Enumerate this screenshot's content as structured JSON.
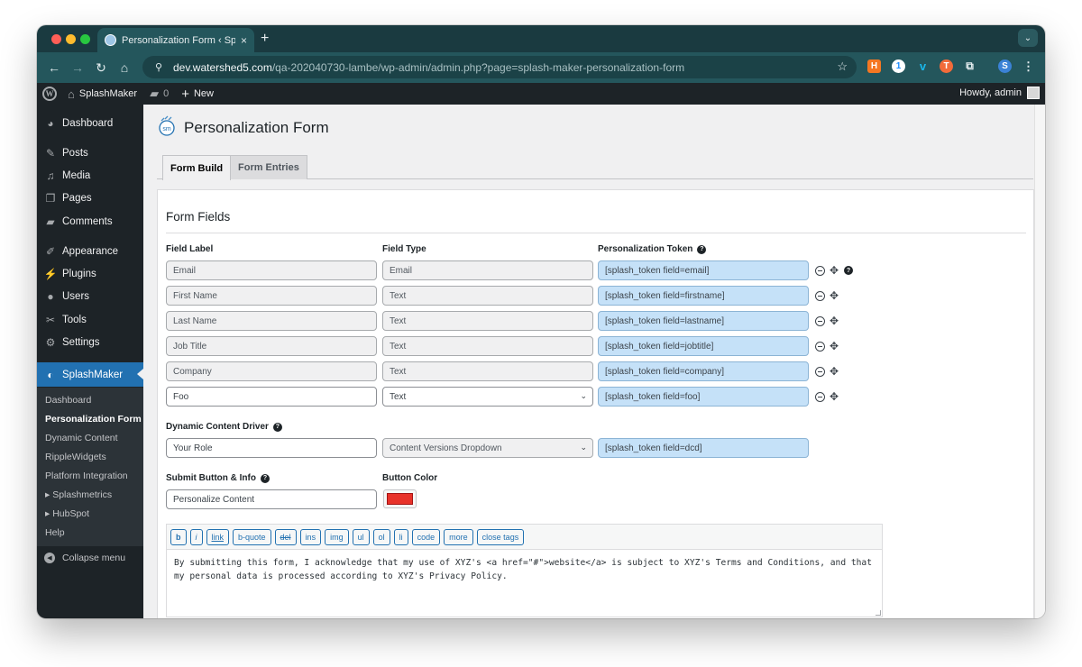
{
  "browser": {
    "tab_title": "Personalization Form ‹ Splash",
    "tab_close": "×",
    "new_tab": "+",
    "tab_menu": "⌄",
    "url_host": "dev.watershed5.com",
    "url_path": "/qa-202040730-lambe/wp-admin/admin.php?page=splash-maker-personalization-form",
    "nav": {
      "back": "←",
      "forward": "→",
      "reload": "↻",
      "home": "⌂"
    },
    "star": "☆",
    "extensions": [
      {
        "name": "hubspot-extension",
        "glyph": "H",
        "color": "#f57722"
      },
      {
        "name": "1password-extension",
        "glyph": "1",
        "color": "#1a8cff"
      },
      {
        "name": "vimeo-extension",
        "glyph": "v",
        "color": "#1ab7ea"
      },
      {
        "name": "t-extension",
        "glyph": "T",
        "color": "#f26b3a"
      },
      {
        "name": "puzzle-extension",
        "glyph": "⧉",
        "color": "#e5eef0"
      }
    ],
    "profile_initial": "S",
    "menu_glyph": "⋮"
  },
  "adminbar": {
    "site_name": "SplashMaker",
    "comments_count": "0",
    "new_label": "New",
    "howdy": "Howdy, admin"
  },
  "sidebar": {
    "items": [
      {
        "label": "Dashboard",
        "icon": "◕"
      },
      {
        "label": "Posts",
        "icon": "✎"
      },
      {
        "label": "Media",
        "icon": "♫"
      },
      {
        "label": "Pages",
        "icon": "❐"
      },
      {
        "label": "Comments",
        "icon": "▰"
      },
      {
        "label": "Appearance",
        "icon": "✐"
      },
      {
        "label": "Plugins",
        "icon": "⚡"
      },
      {
        "label": "Users",
        "icon": "●"
      },
      {
        "label": "Tools",
        "icon": "✂"
      },
      {
        "label": "Settings",
        "icon": "⚙"
      },
      {
        "label": "SplashMaker",
        "icon": "◐"
      }
    ],
    "submenu": [
      "Dashboard",
      "Personalization Form",
      "Dynamic Content",
      "RippleWidgets",
      "Platform Integration",
      "▸ Splashmetrics",
      "▸ HubSpot",
      "Help"
    ],
    "collapse_label": "Collapse menu"
  },
  "page": {
    "title": "Personalization Form",
    "tabs": [
      {
        "label": "Form Build",
        "active": true
      },
      {
        "label": "Form Entries",
        "active": false
      }
    ],
    "section_title": "Form Fields",
    "columns": {
      "field_label": "Field Label",
      "field_type": "Field Type",
      "token": "Personalization Token"
    },
    "rows": [
      {
        "label": "Email",
        "type": "Email",
        "token": "[splash_token field=email]",
        "editable": false
      },
      {
        "label": "First Name",
        "type": "Text",
        "token": "[splash_token field=firstname]",
        "editable": false
      },
      {
        "label": "Last Name",
        "type": "Text",
        "token": "[splash_token field=lastname]",
        "editable": false
      },
      {
        "label": "Job Title",
        "type": "Text",
        "token": "[splash_token field=jobtitle]",
        "editable": false
      },
      {
        "label": "Company",
        "type": "Text",
        "token": "[splash_token field=company]",
        "editable": false
      },
      {
        "label": "Foo",
        "type": "Text",
        "token": "[splash_token field=foo]",
        "editable": true
      }
    ],
    "dcd": {
      "heading": "Dynamic Content Driver",
      "label_value": "Your Role",
      "type_value": "Content Versions Dropdown",
      "token": "[splash_token field=dcd]"
    },
    "submit": {
      "heading": "Submit Button & Info",
      "color_heading": "Button Color",
      "label_value": "Personalize Content",
      "button_color": "#e8322a"
    },
    "quicktags": [
      "b",
      "i",
      "link",
      "b-quote",
      "del",
      "ins",
      "img",
      "ul",
      "ol",
      "li",
      "code",
      "more",
      "close tags"
    ],
    "editor_text": "By submitting this form, I acknowledge that my use of XYZ's <a href=\"#\">website</a> is subject to XYZ's Terms and Conditions, and that\nmy personal data is processed according to XYZ's Privacy Policy."
  },
  "colors": {
    "accent": "#2271b1",
    "token_bg": "#c5e1f8",
    "browser_chrome": "#24565c"
  }
}
